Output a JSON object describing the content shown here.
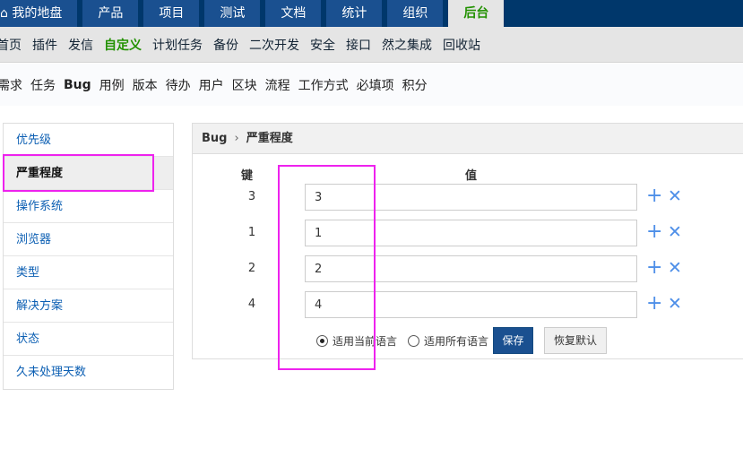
{
  "topnav": {
    "tabs": [
      "我的地盘",
      "产品",
      "项目",
      "测试",
      "文档",
      "统计",
      "组织",
      "后台"
    ],
    "active": "后台"
  },
  "subnav": {
    "items": [
      "首页",
      "插件",
      "发信",
      "自定义",
      "计划任务",
      "备份",
      "二次开发",
      "安全",
      "接口",
      "然之集成",
      "回收站"
    ],
    "active": "自定义"
  },
  "modules": {
    "items": [
      "需求",
      "任务",
      "Bug",
      "用例",
      "版本",
      "待办",
      "用户",
      "区块",
      "流程",
      "工作方式",
      "必填项",
      "积分"
    ],
    "active": "Bug"
  },
  "sidebar": {
    "items": [
      "优先级",
      "严重程度",
      "操作系统",
      "浏览器",
      "类型",
      "解决方案",
      "状态",
      "久未处理天数"
    ],
    "active": "严重程度"
  },
  "panel": {
    "breadcrumb": {
      "module": "Bug",
      "separator": "›",
      "page": "严重程度"
    },
    "key_header": "键",
    "value_header": "值",
    "rows": [
      {
        "key": "3",
        "value": "3"
      },
      {
        "key": "1",
        "value": "1"
      },
      {
        "key": "2",
        "value": "2"
      },
      {
        "key": "4",
        "value": "4"
      }
    ],
    "add_icon": "+",
    "delete_icon": "✕",
    "radio_current": "适用当前语言",
    "radio_all": "适用所有语言",
    "radio_selected": "current",
    "save_label": "保存",
    "reset_label": "恢复默认"
  },
  "colors": {
    "nav": "#1a5090",
    "accent": "#229100",
    "highlight": "#ee22ee"
  }
}
